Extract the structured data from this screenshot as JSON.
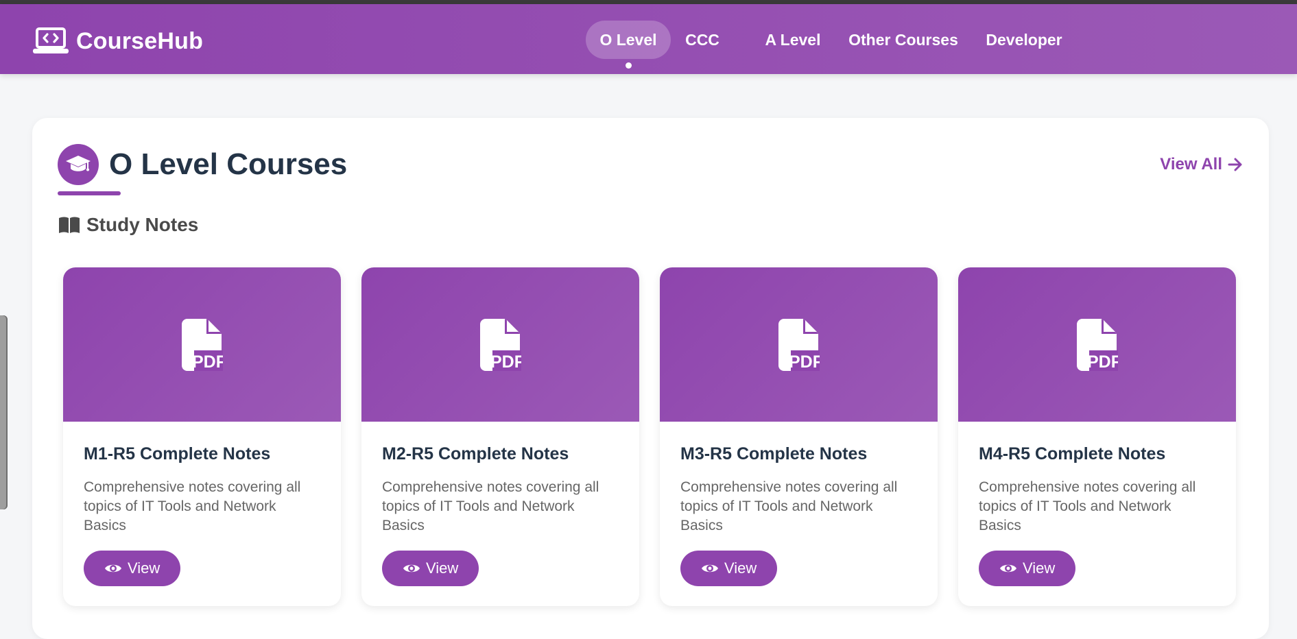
{
  "header": {
    "brand": "CourseHub",
    "nav": [
      {
        "label": "O Level",
        "active": true
      },
      {
        "label": "CCC",
        "active": false
      },
      {
        "label": "A Level",
        "active": false
      },
      {
        "label": "Other Courses",
        "active": false
      },
      {
        "label": "Developer",
        "active": false
      }
    ]
  },
  "section": {
    "title": "O Level Courses",
    "view_all": "View All",
    "subsection": "Study Notes"
  },
  "cards": [
    {
      "title": "M1-R5 Complete Notes",
      "description": "Comprehensive notes covering all topics of IT Tools and Network Basics",
      "button": "View"
    },
    {
      "title": "M2-R5 Complete Notes",
      "description": "Comprehensive notes covering all topics of IT Tools and Network Basics",
      "button": "View"
    },
    {
      "title": "M3-R5 Complete Notes",
      "description": "Comprehensive notes covering all topics of IT Tools and Network Basics",
      "button": "View"
    },
    {
      "title": "M4-R5 Complete Notes",
      "description": "Comprehensive notes covering all topics of IT Tools and Network Basics",
      "button": "View"
    }
  ],
  "colors": {
    "brand": "#8e44ad",
    "brand_light": "#9b59b6",
    "title_text": "#243447"
  },
  "icons": {
    "brand": "laptop-code-icon",
    "section": "graduation-cap-icon",
    "subsection": "open-book-icon",
    "card": "pdf-file-icon",
    "button": "eye-icon",
    "view_all": "arrow-right-icon"
  }
}
